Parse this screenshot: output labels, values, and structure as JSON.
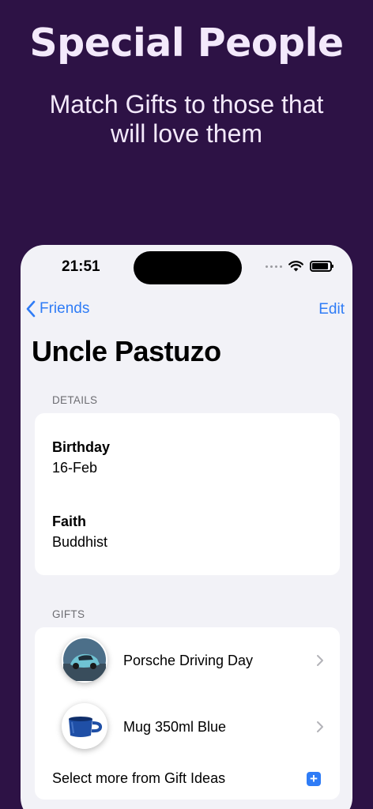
{
  "promo": {
    "title": "Special People",
    "subtitle": "Match Gifts to those that will love them"
  },
  "status_bar": {
    "time": "21:51"
  },
  "nav": {
    "back_label": "Friends",
    "edit_label": "Edit"
  },
  "page": {
    "title": "Uncle Pastuzo"
  },
  "details": {
    "header": "DETAILS",
    "items": [
      {
        "label": "Birthday",
        "value": "16-Feb"
      },
      {
        "label": "Faith",
        "value": "Buddhist"
      }
    ]
  },
  "gifts": {
    "header": "GIFTS",
    "items": [
      {
        "name": "Porsche Driving Day",
        "icon": "car-photo-icon"
      },
      {
        "name": "Mug 350ml Blue",
        "icon": "mug-photo-icon"
      }
    ],
    "more_label": "Select more from Gift Ideas",
    "add_symbol": "+"
  },
  "colors": {
    "background": "#2d1245",
    "accent": "#2f7cf6",
    "promo_text": "#f3e9fb"
  }
}
